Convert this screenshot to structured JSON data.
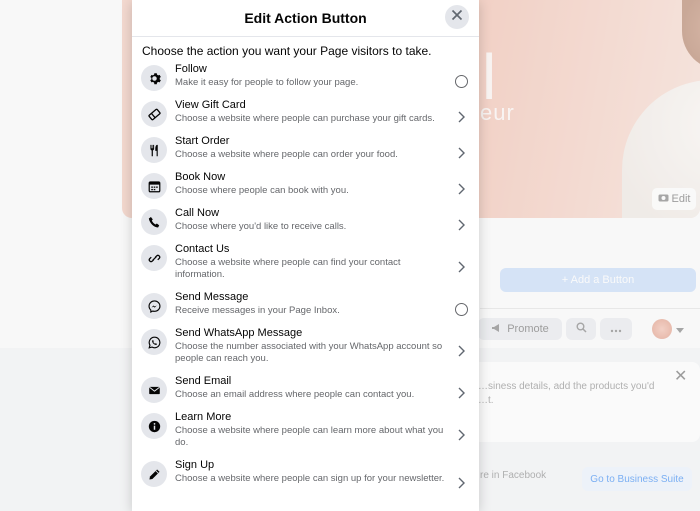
{
  "background": {
    "cover_title": "l",
    "cover_subtitle": "eur",
    "cover_edit_label": "Edit",
    "add_button_label": "+ Add a Button",
    "promote_label": "Promote",
    "card_text": "…siness details, add the products you'd …t.",
    "facebook_row_text": "…re in Facebook",
    "business_suite_label": "Go to Business Suite"
  },
  "modal": {
    "title": "Edit Action Button",
    "intro": "Choose the action you want your Page visitors to take.",
    "options": [
      {
        "title": "Follow",
        "desc": "Make it easy for people to follow your page.",
        "icon": "gear-icon",
        "control": "radio"
      },
      {
        "title": "View Gift Card",
        "desc": "Choose a website where people can purchase your gift cards.",
        "icon": "gift-card-icon",
        "control": "chevron"
      },
      {
        "title": "Start Order",
        "desc": "Choose a website where people can order your food.",
        "icon": "utensils-icon",
        "control": "chevron"
      },
      {
        "title": "Book Now",
        "desc": "Choose where people can book with you.",
        "icon": "calendar-icon",
        "control": "chevron"
      },
      {
        "title": "Call Now",
        "desc": "Choose where you'd like to receive calls.",
        "icon": "phone-icon",
        "control": "chevron"
      },
      {
        "title": "Contact Us",
        "desc": "Choose a website where people can find your contact information.",
        "icon": "link-icon",
        "control": "chevron"
      },
      {
        "title": "Send Message",
        "desc": "Receive messages in your Page Inbox.",
        "icon": "messenger-icon",
        "control": "radio"
      },
      {
        "title": "Send WhatsApp Message",
        "desc": "Choose the number associated with your WhatsApp account so people can reach you.",
        "icon": "whatsapp-icon",
        "control": "chevron"
      },
      {
        "title": "Send Email",
        "desc": "Choose an email address where people can contact you.",
        "icon": "envelope-icon",
        "control": "chevron"
      },
      {
        "title": "Learn More",
        "desc": "Choose a website where people can learn more about what you do.",
        "icon": "info-icon",
        "control": "chevron"
      },
      {
        "title": "Sign Up",
        "desc": "Choose a website where people can sign up for your newsletter.",
        "icon": "pencil-icon",
        "control": "chevron"
      }
    ]
  }
}
